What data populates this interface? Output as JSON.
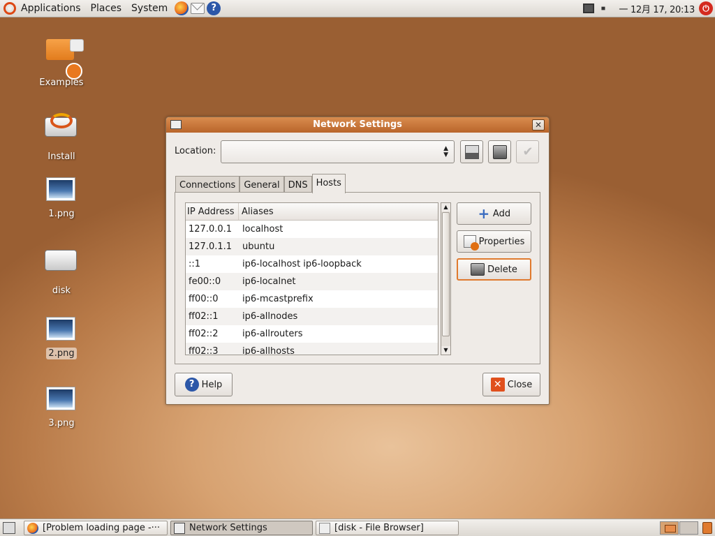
{
  "top_panel": {
    "menus": [
      "Applications",
      "Places",
      "System"
    ],
    "clock": "一 12月 17, 20:13"
  },
  "desktop_icons": [
    {
      "label": "Examples"
    },
    {
      "label": "Install"
    },
    {
      "label": "1.png"
    },
    {
      "label": "disk"
    },
    {
      "label": "2.png",
      "selected": true
    },
    {
      "label": "3.png"
    }
  ],
  "window": {
    "title": "Network Settings",
    "location_label": "Location:",
    "location_value": "",
    "tabs": [
      "Connections",
      "General",
      "DNS",
      "Hosts"
    ],
    "active_tab": "Hosts",
    "columns": [
      "IP Address",
      "Aliases"
    ],
    "hosts": [
      {
        "ip": "127.0.0.1",
        "aliases": "localhost"
      },
      {
        "ip": "127.0.1.1",
        "aliases": "ubuntu"
      },
      {
        "ip": "::1",
        "aliases": "ip6-localhost ip6-loopback"
      },
      {
        "ip": "fe00::0",
        "aliases": "ip6-localnet"
      },
      {
        "ip": "ff00::0",
        "aliases": "ip6-mcastprefix"
      },
      {
        "ip": "ff02::1",
        "aliases": "ip6-allnodes"
      },
      {
        "ip": "ff02::2",
        "aliases": "ip6-allrouters"
      },
      {
        "ip": "ff02::3",
        "aliases": "ip6-allhosts"
      }
    ],
    "buttons": {
      "add": "Add",
      "properties": "Properties",
      "delete": "Delete",
      "help": "Help",
      "close": "Close"
    }
  },
  "taskbar": [
    {
      "label": "[Problem loading page -···",
      "active": false
    },
    {
      "label": "Network Settings",
      "active": true
    },
    {
      "label": "[disk - File Browser]",
      "active": false
    }
  ],
  "colors": {
    "accent": "#e07a2e",
    "titlebar": "#c8743a",
    "desktop": "#d7a271"
  }
}
